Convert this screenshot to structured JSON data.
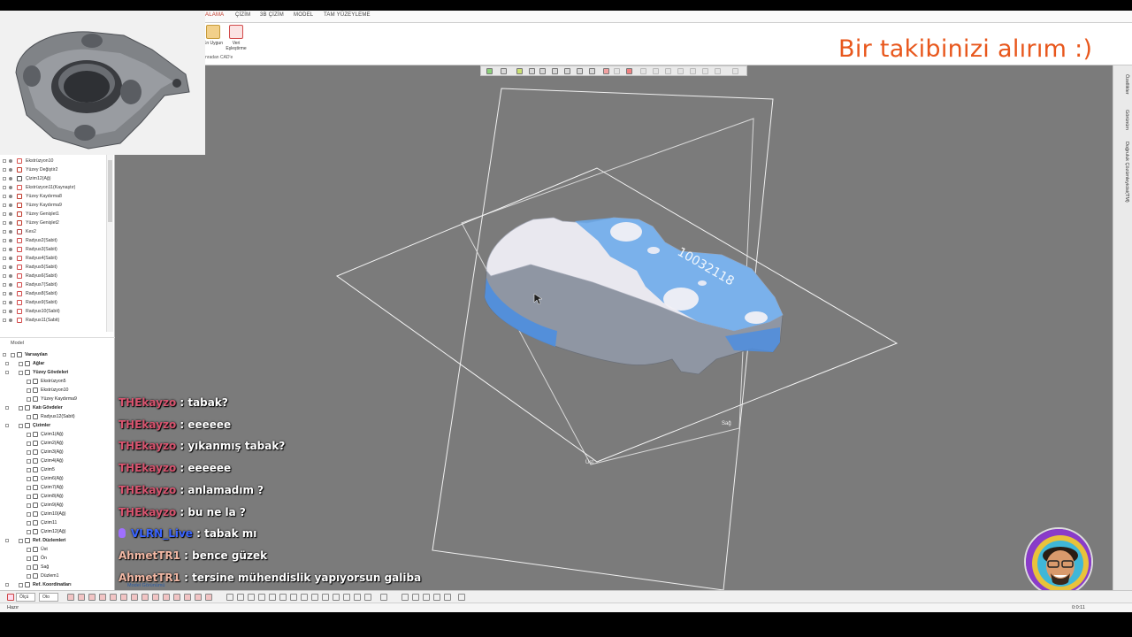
{
  "ribbon": {
    "tabs": [
      {
        "label": "ALAMA",
        "active": true
      },
      {
        "label": "ÇİZİM",
        "active": false
      },
      {
        "label": "3B ÇİZİM",
        "active": false
      },
      {
        "label": "MODEL",
        "active": false
      },
      {
        "label": "TAM YÜZEYLEME",
        "active": false
      }
    ],
    "buttons": [
      {
        "label": "En Uygun"
      },
      {
        "label": "Veri Eşleştirme"
      }
    ],
    "group_label": "nradan CAD'e"
  },
  "overlay_text": "Bir takibinizi alırım :)",
  "feature_tree": [
    {
      "label": "Ekstrüzyon10",
      "icon": "extrude-icon"
    },
    {
      "label": "Yüzey Değiştir2",
      "icon": "surface-icon"
    },
    {
      "label": "Çizim12(Ağ)",
      "icon": "sketch-icon"
    },
    {
      "label": "Ekstrüzyon11(Kaynaştır)",
      "icon": "extrude-icon"
    },
    {
      "label": "Yüzey Kaydırma8",
      "icon": "surface-icon"
    },
    {
      "label": "Yüzey Kaydırma9",
      "icon": "surface-icon"
    },
    {
      "label": "Yüzey Genişlet1",
      "icon": "surface-icon"
    },
    {
      "label": "Yüzey Genişlet2",
      "icon": "surface-icon"
    },
    {
      "label": "Kes2",
      "icon": "cut-icon"
    },
    {
      "label": "Radyus2(Sabit)",
      "icon": "fillet-icon"
    },
    {
      "label": "Radyus3(Sabit)",
      "icon": "fillet-icon"
    },
    {
      "label": "Radyus4(Sabit)",
      "icon": "fillet-icon"
    },
    {
      "label": "Radyus5(Sabit)",
      "icon": "fillet-icon"
    },
    {
      "label": "Radyus6(Sabit)",
      "icon": "fillet-icon"
    },
    {
      "label": "Radyus7(Sabit)",
      "icon": "fillet-icon"
    },
    {
      "label": "Radyus8(Sabit)",
      "icon": "fillet-icon"
    },
    {
      "label": "Radyus9(Sabit)",
      "icon": "fillet-icon"
    },
    {
      "label": "Radyus10(Sabit)",
      "icon": "fillet-icon"
    },
    {
      "label": "Radyus11(Sabit)",
      "icon": "fillet-icon"
    }
  ],
  "model_label": "Model",
  "structure_tree": [
    {
      "label": "Varsayılan",
      "bold": true,
      "level": 0
    },
    {
      "label": "Ağlar",
      "bold": true,
      "level": 1
    },
    {
      "label": "Yüzey Gövdeleri",
      "bold": true,
      "level": 1
    },
    {
      "label": "Ekstrüzyon5",
      "bold": false,
      "level": 2
    },
    {
      "label": "Ekstrüzyon10",
      "bold": false,
      "level": 2
    },
    {
      "label": "Yüzey Kaydırma9",
      "bold": false,
      "level": 2
    },
    {
      "label": "Katı Gövdeler",
      "bold": true,
      "level": 1
    },
    {
      "label": "Radyus12(Sabit)",
      "bold": false,
      "level": 2
    },
    {
      "label": "Çizimler",
      "bold": true,
      "level": 1
    },
    {
      "label": "Çizim1(Ağ)",
      "bold": false,
      "level": 2
    },
    {
      "label": "Çizim2(Ağ)",
      "bold": false,
      "level": 2
    },
    {
      "label": "Çizim3(Ağ)",
      "bold": false,
      "level": 2
    },
    {
      "label": "Çizim4(Ağ)",
      "bold": false,
      "level": 2
    },
    {
      "label": "Çizim5",
      "bold": false,
      "level": 2
    },
    {
      "label": "Çizim6(Ağ)",
      "bold": false,
      "level": 2
    },
    {
      "label": "Çizim7(Ağ)",
      "bold": false,
      "level": 2
    },
    {
      "label": "Çizim8(Ağ)",
      "bold": false,
      "level": 2
    },
    {
      "label": "Çizim9(Ağ)",
      "bold": false,
      "level": 2
    },
    {
      "label": "Çizim10(Ağ)",
      "bold": false,
      "level": 2
    },
    {
      "label": "Çizim11",
      "bold": false,
      "level": 2
    },
    {
      "label": "Çizim12(Ağ)",
      "bold": false,
      "level": 2
    },
    {
      "label": "Ref. Düzlemleri",
      "bold": true,
      "level": 1
    },
    {
      "label": "Üst",
      "bold": false,
      "level": 2
    },
    {
      "label": "Ön",
      "bold": false,
      "level": 2
    },
    {
      "label": "Sağ",
      "bold": false,
      "level": 2
    },
    {
      "label": "Düzlem1",
      "bold": false,
      "level": 2
    },
    {
      "label": "Ref. Koordinatları",
      "bold": true,
      "level": 1
    }
  ],
  "viewport": {
    "plane_labels": {
      "right": "Sağ",
      "top": "Üst"
    },
    "part_engraving": "10032118"
  },
  "side_panel": [
    {
      "label": "Özellikler"
    },
    {
      "label": "Görünüm"
    },
    {
      "label": "Doğruluk Çözümleyicisi(TM)"
    }
  ],
  "chat": [
    {
      "user": "THEkayzo",
      "message": " : tabak?",
      "user_color": "#d8546f",
      "badge": false
    },
    {
      "user": "THEkayzo",
      "message": " : eeeeee",
      "user_color": "#d8546f",
      "badge": false
    },
    {
      "user": "THEkayzo",
      "message": " : yıkanmış tabak?",
      "user_color": "#d8546f",
      "badge": false
    },
    {
      "user": "THEkayzo",
      "message": " : eeeeee",
      "user_color": "#d8546f",
      "badge": false
    },
    {
      "user": "THEkayzo",
      "message": " : anlamadım ?",
      "user_color": "#d8546f",
      "badge": false
    },
    {
      "user": "THEkayzo",
      "message": " : bu ne la ?",
      "user_color": "#d8546f",
      "badge": false
    },
    {
      "user": "VLRN_Live",
      "message": " : tabak mı",
      "user_color": "#3a64ff",
      "badge": true
    },
    {
      "user": "AhmetTR1",
      "message": " : bence güzek",
      "user_color": "#f2b8a4",
      "badge": false
    },
    {
      "user": "AhmetTR1",
      "message": " : tersine mühendislik yapıyorsun galiba",
      "user_color": "#f2b8a4",
      "badge": false
    }
  ],
  "doc_tab": "Model Görünümü",
  "bottom_toolbar": {
    "select_1": "Ölçü",
    "select_2": "Oto"
  },
  "status": {
    "left": "Hazır",
    "right": "0:0:11"
  },
  "colors": {
    "accent": "#c0392b",
    "overlay_text": "#e8571c",
    "viewport_bg": "#7b7b7b",
    "part_blue": "#4d8ee0"
  }
}
